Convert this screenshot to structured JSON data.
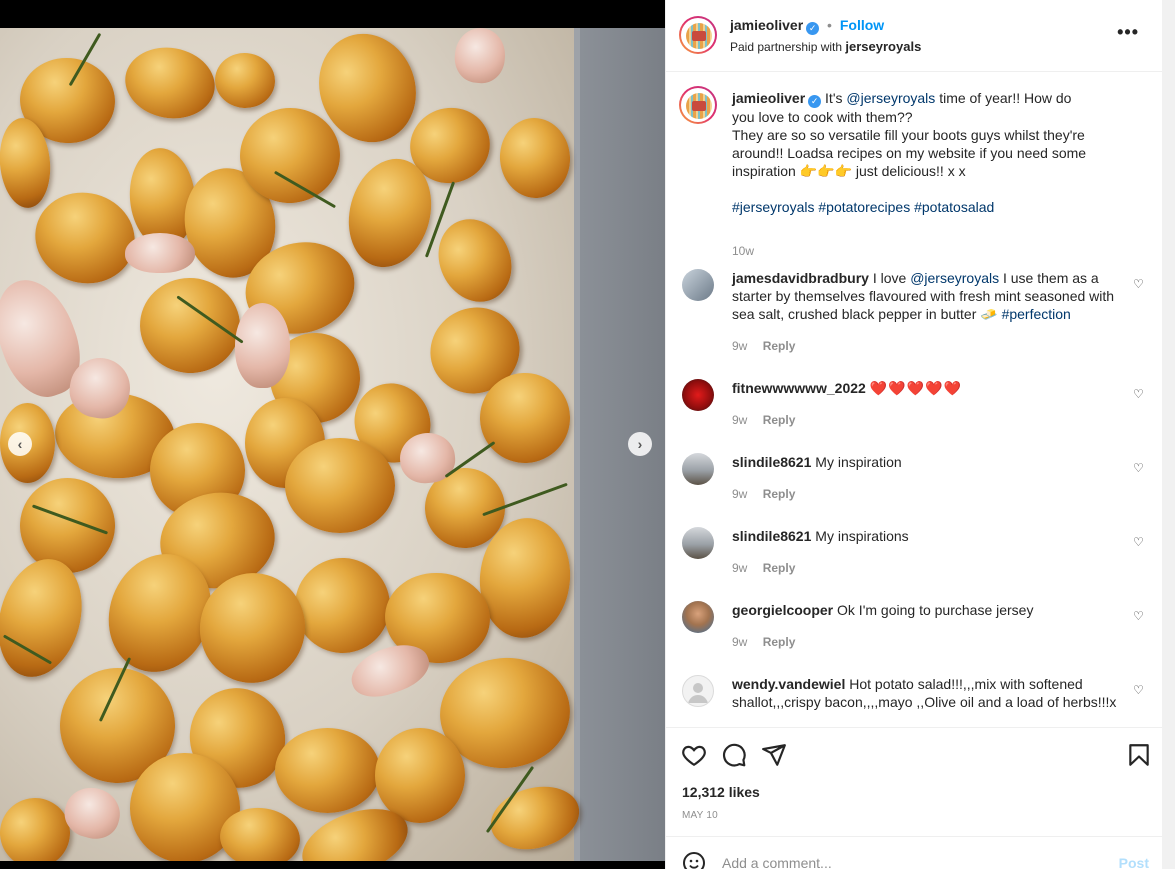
{
  "post": {
    "author": "jamieoliver",
    "follow_label": "Follow",
    "separator": "•",
    "partnership_prefix": "Paid partnership with",
    "partner": "jerseyroyals",
    "more_label": "•••"
  },
  "caption": {
    "author": "jamieoliver",
    "text_1": "It's",
    "mention": "@jerseyroyals",
    "text_2": "time of year!! How do you love to cook with them??",
    "text_3": "They are so so versatile fill your boots guys whilst they're around!! Loadsa recipes on my website if you need some inspiration 👉👉👉 just delicious!! x x",
    "hashtags": [
      "#jerseyroyals",
      "#potatorecipes",
      "#potatosalad"
    ],
    "age": "10w"
  },
  "comments": [
    {
      "user": "jamesdavidbradbury",
      "pre": "I love",
      "mention": "@jerseyroyals",
      "post": "I use them as a starter by themselves flavoured with fresh mint seasoned with sea salt, crushed black pepper in butter 🧈",
      "tag": "#perfection",
      "age": "9w",
      "reply": "Reply"
    },
    {
      "user": "fitnewwwwww_2022",
      "text": "❤️❤️❤️❤️❤️",
      "age": "9w",
      "reply": "Reply"
    },
    {
      "user": "slindile8621",
      "text": "My inspiration",
      "age": "9w",
      "reply": "Reply"
    },
    {
      "user": "slindile8621",
      "text": "My inspirations",
      "age": "9w",
      "reply": "Reply"
    },
    {
      "user": "georgielcooper",
      "text": "Ok I'm going to purchase jersey",
      "age": "9w",
      "reply": "Reply"
    },
    {
      "user": "wendy.vandewiel",
      "text": "Hot potato salad!!!,,,mix with softened shallot,,,crispy bacon,,,,mayo ,,Olive oil and a load of herbs!!!x"
    }
  ],
  "actions": {
    "likes": "12,312 likes",
    "date": "MAY 10"
  },
  "add_comment": {
    "placeholder": "Add a comment...",
    "post_label": "Post"
  },
  "carousel": {
    "prev": "‹",
    "next": "›",
    "slides": 4,
    "active": 0
  }
}
